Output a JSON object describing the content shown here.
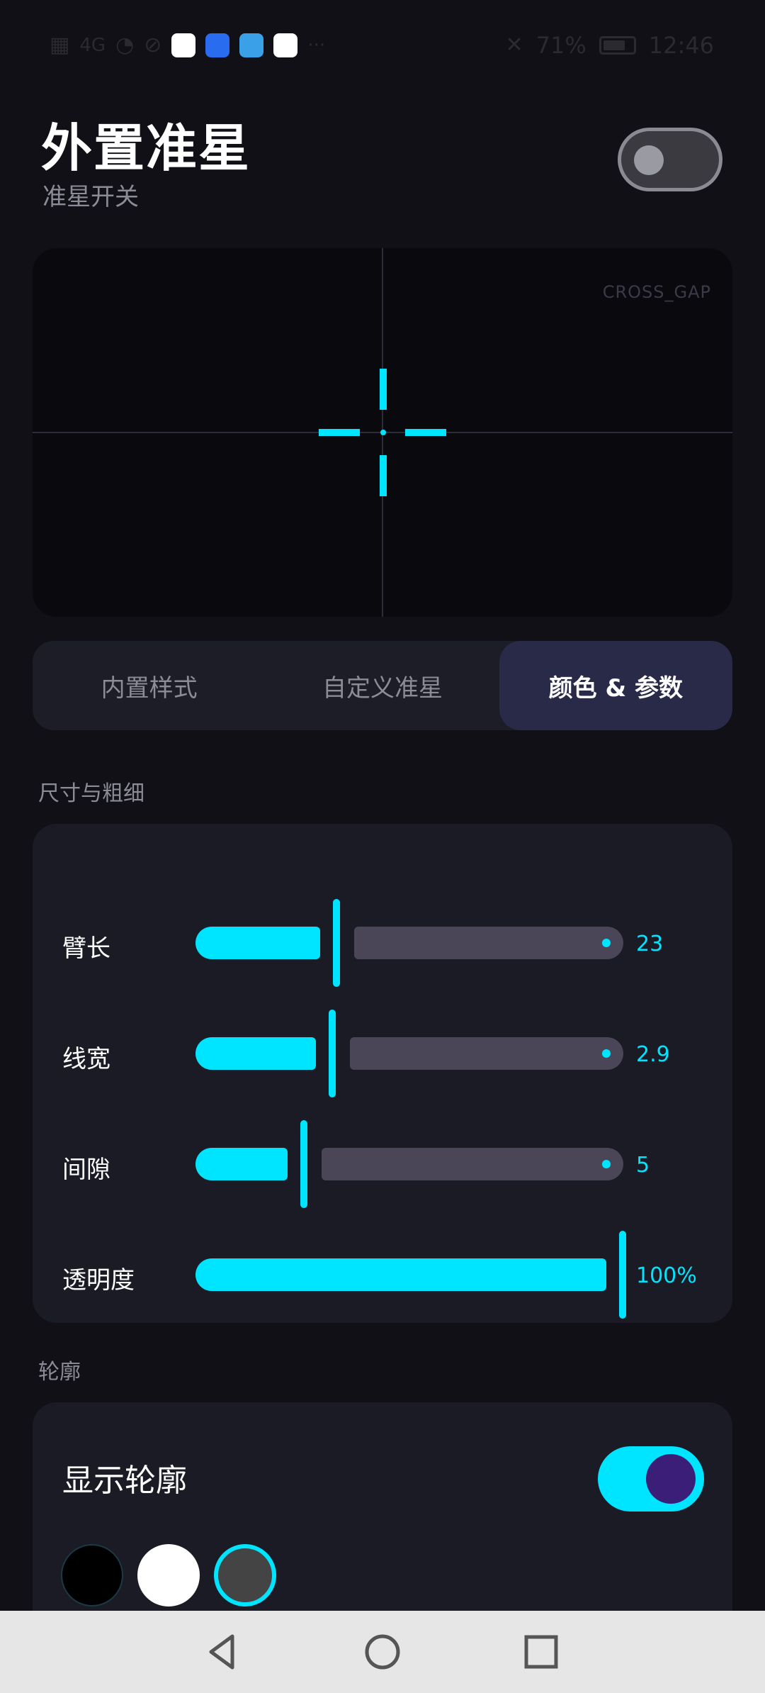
{
  "status_bar": {
    "battery_percent": "71%",
    "time": "12:46",
    "signal_text": "4G",
    "more_glyph": "···",
    "app_icons": [
      {
        "name": "qq-icon",
        "color": "#ffffff"
      },
      {
        "name": "app-store-icon",
        "color": "#2a6cf0"
      },
      {
        "name": "book-icon",
        "color": "#3aa0e8"
      },
      {
        "name": "browser-icon",
        "color": "#ffffff"
      }
    ]
  },
  "header": {
    "title": "外置准星",
    "subtitle": "准星开关",
    "toggle_on": false
  },
  "preview": {
    "mode_label": "CROSS_GAP",
    "crosshair_color": "#00e5ff"
  },
  "tabs": [
    {
      "label": "内置样式",
      "active": false
    },
    {
      "label": "自定义准星",
      "active": false
    },
    {
      "label": "颜色 & 参数",
      "active": true
    }
  ],
  "size_section": {
    "label": "尺寸与粗细",
    "sliders": [
      {
        "label": "臂长",
        "value": "23",
        "fraction": 0.33
      },
      {
        "label": "线宽",
        "value": "2.9",
        "fraction": 0.32
      },
      {
        "label": "间隙",
        "value": "5",
        "fraction": 0.25
      },
      {
        "label": "透明度",
        "value": "100%",
        "fraction": 1.0
      }
    ]
  },
  "outline_section": {
    "label": "轮廓",
    "show_outline_label": "显示轮廓",
    "toggle_on": true,
    "swatches": [
      {
        "color": "#000000",
        "selected": false
      },
      {
        "color": "#ffffff",
        "selected": false
      },
      {
        "color": "#444444",
        "selected": true
      }
    ]
  },
  "colors": {
    "accent": "#00e5ff",
    "background": "#101016",
    "card": "#1b1b26"
  }
}
